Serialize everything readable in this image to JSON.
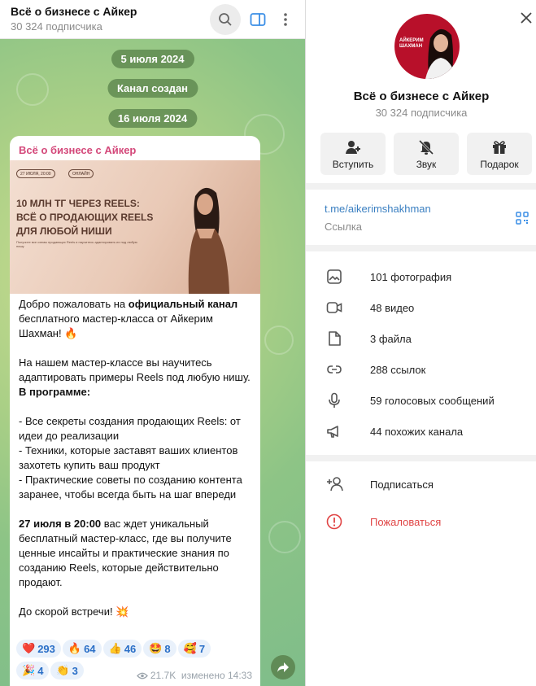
{
  "header": {
    "title": "Всё о бизнесе с Айкер",
    "subtitle": "30 324 подписчика"
  },
  "dates": [
    "5 июля 2024",
    "Канал создан",
    "16 июля 2024"
  ],
  "post": {
    "channel_name": "Всё о бизнесе с Айкер",
    "promo_chips": [
      "27 ИЮЛЯ, 20:00",
      "ОНЛАЙН"
    ],
    "promo_title": [
      "10 МЛН ТГ ЧЕРЕЗ REELS:",
      "ВСЁ О ПРОДАЮЩИХ REELS",
      "ДЛЯ ЛЮБОЙ НИШИ"
    ],
    "promo_sub": "Получите все схемы продающих Reels и научитесь адаптировать их под любую нишу",
    "p1_a": "Добро пожаловать на ",
    "p1_b": "официальный канал",
    "p1_c": " бесплатного мастер-класса от Айкерим Шахман! 🔥",
    "p2": "На нашем мастер-классе вы научитесь адаптировать примеры Reels под любую нишу.",
    "p3": "В программе:",
    "b1": "- Все секреты создания продающих Reels: от идеи до реализации",
    "b2": "- Техники, которые заставят ваших клиентов захотеть купить ваш продукт",
    "b3": "- Практические советы по созданию контента заранее, чтобы всегда быть на шаг впереди",
    "p4_a": "27 июля в 20:00",
    "p4_b": " вас ждет уникальный бесплатный мастер-класс, где вы получите ценные инсайты и практические знания по созданию Reels, которые действительно продают.",
    "p5": "До скорой встречи! 💥",
    "reactions": [
      {
        "emoji": "❤️",
        "count": "293"
      },
      {
        "emoji": "🔥",
        "count": "64"
      },
      {
        "emoji": "👍",
        "count": "46"
      },
      {
        "emoji": "🤩",
        "count": "8"
      },
      {
        "emoji": "🥰",
        "count": "7"
      },
      {
        "emoji": "🎉",
        "count": "4"
      },
      {
        "emoji": "👏",
        "count": "3"
      }
    ],
    "views": "21.7K",
    "edited": "изменено 14:33"
  },
  "profile": {
    "avatar_text": "АЙКЕРИМ ШАХМАН",
    "title": "Всё о бизнесе с Айкер",
    "subtitle": "30 324 подписчика",
    "actions": [
      {
        "label": "Вступить",
        "icon": "add-user-icon"
      },
      {
        "label": "Звук",
        "icon": "bell-off-icon"
      },
      {
        "label": "Подарок",
        "icon": "gift-icon"
      }
    ],
    "link": "t.me/aikerimshakhman",
    "link_label": "Ссылка",
    "media": [
      {
        "label": "101 фотография",
        "icon": "photo-icon"
      },
      {
        "label": "48 видео",
        "icon": "video-icon"
      },
      {
        "label": "3 файла",
        "icon": "file-icon"
      },
      {
        "label": "288 ссылок",
        "icon": "link-icon"
      },
      {
        "label": "59 голосовых сообщений",
        "icon": "mic-icon"
      },
      {
        "label": "44 похожих канала",
        "icon": "megaphone-icon"
      }
    ],
    "subscribe": "Подписаться",
    "report": "Пожаловаться"
  },
  "colors": {
    "accent": "#3a7fc1",
    "name": "#d4487a",
    "danger": "#e04444",
    "wallpaper": "#a9cf86"
  }
}
